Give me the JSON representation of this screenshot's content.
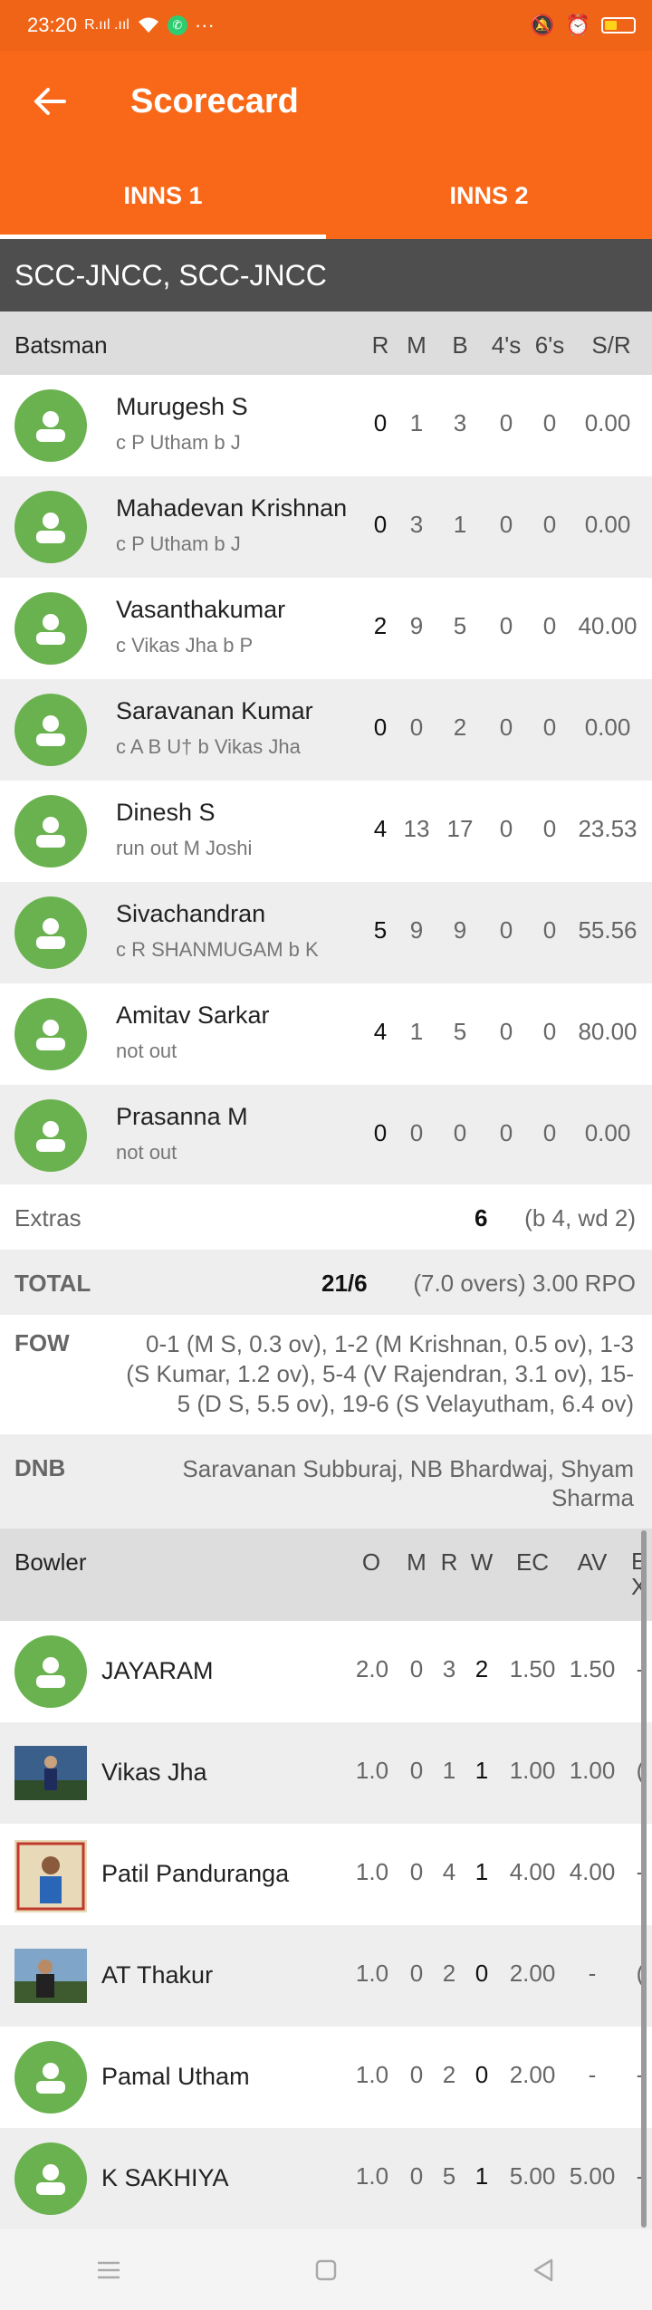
{
  "status_bar": {
    "time": "23:20",
    "signal": "R.ııl .ııl",
    "dots": "···"
  },
  "app_bar": {
    "title": "Scorecard"
  },
  "tabs": [
    {
      "label": "INNS 1"
    },
    {
      "label": "INNS 2"
    }
  ],
  "team": {
    "name": "SCC-JNCC, SCC-JNCC"
  },
  "batting": {
    "header": {
      "label": "Batsman",
      "cols": [
        "R",
        "M",
        "B",
        "4's",
        "6's",
        "S/R"
      ]
    },
    "rows": [
      {
        "name": "Murugesh S",
        "dismissal": "c P Utham b J",
        "r": "0",
        "m": "1",
        "b": "3",
        "fours": "0",
        "sixes": "0",
        "sr": "0.00"
      },
      {
        "name": "Mahadevan Krishnan",
        "dismissal": "c P Utham b J",
        "r": "0",
        "m": "3",
        "b": "1",
        "fours": "0",
        "sixes": "0",
        "sr": "0.00"
      },
      {
        "name": "Vasanthakumar",
        "dismissal": "c Vikas Jha b P",
        "r": "2",
        "m": "9",
        "b": "5",
        "fours": "0",
        "sixes": "0",
        "sr": "40.00"
      },
      {
        "name": "Saravanan Kumar",
        "dismissal": "c A B U† b Vikas Jha",
        "r": "0",
        "m": "0",
        "b": "2",
        "fours": "0",
        "sixes": "0",
        "sr": "0.00"
      },
      {
        "name": "Dinesh S",
        "dismissal": "run out M Joshi",
        "r": "4",
        "m": "13",
        "b": "17",
        "fours": "0",
        "sixes": "0",
        "sr": "23.53"
      },
      {
        "name": "Sivachandran",
        "dismissal": "c R SHANMUGAM b K",
        "r": "5",
        "m": "9",
        "b": "9",
        "fours": "0",
        "sixes": "0",
        "sr": "55.56"
      },
      {
        "name": "Amitav Sarkar",
        "dismissal": "not out",
        "r": "4",
        "m": "1",
        "b": "5",
        "fours": "0",
        "sixes": "0",
        "sr": "80.00"
      },
      {
        "name": "Prasanna M",
        "dismissal": "not out",
        "r": "0",
        "m": "0",
        "b": "0",
        "fours": "0",
        "sixes": "0",
        "sr": "0.00"
      }
    ]
  },
  "extras": {
    "label": "Extras",
    "value": "6",
    "detail": "(b 4, wd 2)"
  },
  "total": {
    "label": "TOTAL",
    "value": "21/6",
    "detail": "(7.0 overs) 3.00 RPO"
  },
  "fow": {
    "label": "FOW",
    "text": "0-1 (M S, 0.3 ov), 1-2 (M Krishnan, 0.5 ov), 1-3 (S Kumar, 1.2 ov), 5-4 (V Rajendran, 3.1 ov), 15-5 (D S, 5.5 ov), 19-6 (S Velayutham, 6.4 ov)"
  },
  "dnb": {
    "label": "DNB",
    "text": "Saravanan Subburaj, NB Bhardwaj, Shyam Sharma"
  },
  "bowling": {
    "header": {
      "label": "Bowler",
      "cols": [
        "O",
        "M",
        "R",
        "W",
        "EC",
        "AV",
        "E X"
      ]
    },
    "rows": [
      {
        "name": "JAYARAM",
        "photo": "avatar-icon",
        "o": "2.0",
        "m": "0",
        "r": "3",
        "w": "2",
        "ec": "1.50",
        "av": "1.50",
        "ex": "-"
      },
      {
        "name": "Vikas Jha",
        "photo": "player-photo",
        "o": "1.0",
        "m": "0",
        "r": "1",
        "w": "1",
        "ec": "1.00",
        "av": "1.00",
        "ex": "("
      },
      {
        "name": "Patil Panduranga",
        "photo": "player-photo",
        "o": "1.0",
        "m": "0",
        "r": "4",
        "w": "1",
        "ec": "4.00",
        "av": "4.00",
        "ex": "-"
      },
      {
        "name": "AT Thakur",
        "photo": "player-photo",
        "o": "1.0",
        "m": "0",
        "r": "2",
        "w": "0",
        "ec": "2.00",
        "av": "-",
        "ex": "("
      },
      {
        "name": "Pamal Utham",
        "photo": "avatar-icon",
        "o": "1.0",
        "m": "0",
        "r": "2",
        "w": "0",
        "ec": "2.00",
        "av": "-",
        "ex": "-"
      },
      {
        "name": "K SAKHIYA",
        "photo": "avatar-icon",
        "o": "1.0",
        "m": "0",
        "r": "5",
        "w": "1",
        "ec": "5.00",
        "av": "5.00",
        "ex": "-"
      }
    ]
  },
  "colors": {
    "primary": "#f96818",
    "avatar": "#6ab24f",
    "team_bar": "#4e4e4e",
    "header_bg": "#dddddd",
    "alt_row": "#eeeeee"
  }
}
